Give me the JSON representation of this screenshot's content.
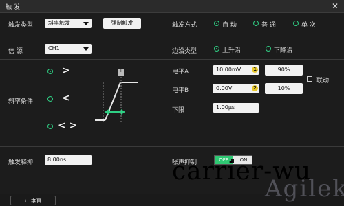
{
  "title": "触 发",
  "row1": {
    "trigger_type_label": "触发类型",
    "trigger_type_value": "斜率触发",
    "force_button": "强制触发",
    "mode_label": "触发方式",
    "mode_options": [
      "自 动",
      "普 通",
      "单 次"
    ],
    "mode_selected": 0
  },
  "source": {
    "label": "信 源",
    "value": "CH1",
    "edge_label": "边沿类型",
    "edge_options": [
      "上升沿",
      "下降沿"
    ],
    "edge_selected": 0
  },
  "slope": {
    "condition_label": "斜率条件",
    "conditions": [
      ">",
      "<",
      "< >"
    ],
    "condition_selected": 0,
    "marker_label": "T",
    "level_a_label": "电平A",
    "level_a_value": "10.00mV",
    "level_a_badge": "1",
    "level_a_pct": "90%",
    "level_b_label": "电平B",
    "level_b_value": "0.00V",
    "level_b_badge": "2",
    "level_b_pct": "10%",
    "link_label": "联动",
    "lower_label": "下限",
    "lower_value": "1.00µs"
  },
  "bottom": {
    "holdoff_label": "触发释抑",
    "holdoff_value": "8.00ns",
    "noise_label": "噪声抑制",
    "noise_off": "OFF",
    "noise_on": "ON"
  },
  "footer": {
    "vertical_button": "垂直"
  },
  "watermark": {
    "text1": "carrier-wu",
    "text2": "Agilek"
  },
  "colors": {
    "accent": "#2fcf84",
    "badge": "#e8c82a",
    "toggle_on": "#2fc873"
  }
}
